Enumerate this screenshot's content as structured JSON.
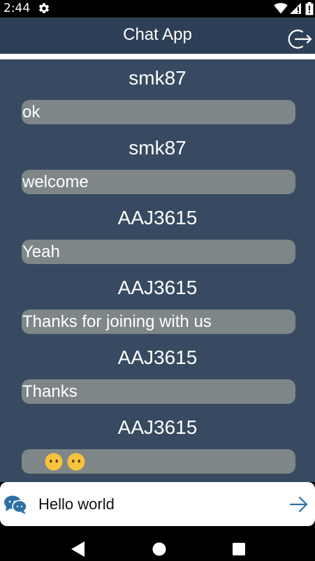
{
  "status_bar": {
    "time": "2:44",
    "icons": [
      "gear-icon",
      "wifi-icon",
      "signal-icon",
      "battery-icon"
    ]
  },
  "app_bar": {
    "title": "Chat App",
    "action_icon": "logout-icon"
  },
  "messages": [
    {
      "sender": "smk87",
      "text": "ok"
    },
    {
      "sender": "smk87",
      "text": "welcome"
    },
    {
      "sender": "AAJ3615",
      "text": "Yeah"
    },
    {
      "sender": "AAJ3615",
      "text": "Thanks for joining with us"
    },
    {
      "sender": "AAJ3615",
      "text": "Thanks"
    },
    {
      "sender": "AAJ3615",
      "text": "😶😶"
    }
  ],
  "composer": {
    "value": "Hello world",
    "icon": "chat-bubbles-icon",
    "send_icon": "send-arrow-icon"
  },
  "nav_bar": {
    "icons": [
      "back-icon",
      "home-icon",
      "recents-icon"
    ]
  },
  "colors": {
    "app_bar": "#2e4057",
    "chat_background": "#374a61",
    "bubble": "#7f8688",
    "accent": "#2e6fa8"
  }
}
